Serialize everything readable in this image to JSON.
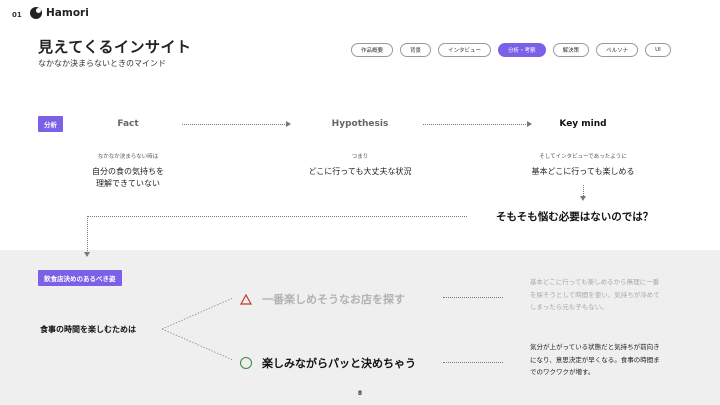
{
  "header": {
    "page_number": "01",
    "logo_text": "Hamori",
    "title": "見えてくるインサイト",
    "subtitle": "なかなか決まらないときのマインド"
  },
  "tabs": [
    {
      "label": "作品概要",
      "active": false
    },
    {
      "label": "背景",
      "active": false
    },
    {
      "label": "インタビュー",
      "active": false
    },
    {
      "label": "分析・考察",
      "active": true
    },
    {
      "label": "解決策",
      "active": false
    },
    {
      "label": "ペルソナ",
      "active": false
    },
    {
      "label": "UI",
      "active": false
    }
  ],
  "analysis": {
    "tag": "分析",
    "fact": {
      "heading": "Fact",
      "note": "なかなか決まらない時は",
      "line1": "自分の食の気持ちを",
      "line2": "理解できていない"
    },
    "hypothesis": {
      "heading": "Hypothesis",
      "note": "つまり",
      "line1": "どこに行っても大丈夫な状況"
    },
    "keymind": {
      "heading": "Key mind",
      "note": "そしてインタビューであったように",
      "line1": "基本どこに行っても楽しめる"
    },
    "question": "そもそも悩む必要はないのでは？"
  },
  "ideal": {
    "tag": "飲食店決めのあるべき姿",
    "label": "食事の時間を楽しむためは",
    "option_bad": "一番楽しめそうなお店を探す",
    "option_good": "楽しみながらパッと決めちゃう",
    "note_bad": {
      "l1": "基本どこに行っても楽しめるから無理に一番",
      "l2": "を探そうとして時間を使い、気持ちが冷めて",
      "l3": "しまったら元も子もない。"
    },
    "note_good": {
      "l1": "気分が上がっている状態だと気持ちが前向き",
      "l2": "になり、意思決定が早くなる。食事の時間ま",
      "l3": "でのワクワクが増す。"
    }
  },
  "footer": {
    "page": "8"
  },
  "colors": {
    "accent": "#7b61e8",
    "band": "#efefef",
    "good_icon": "#3a8a3a",
    "bad_icon": "#c0392b"
  }
}
